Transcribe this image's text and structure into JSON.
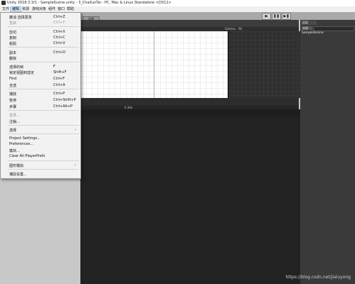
{
  "window": {
    "title": "Unity 2018.3.1f1 - SampleScene.unity - 3_ChaXunTai - PC, Mac & Linux Standalone <DX11>"
  },
  "menubar": {
    "items": [
      "文件",
      "编辑",
      "资源",
      "游戏对象",
      "组件",
      "窗口",
      "帮助"
    ]
  },
  "toolbar": {
    "scene_tab": "场景",
    "play": "▶",
    "pause": "❚❚",
    "step": "▶❚"
  },
  "edit_menu": {
    "undo": {
      "label": "撤消 选择更改",
      "shortcut": "Ctrl+Z"
    },
    "redo": {
      "label": "重做",
      "shortcut": "Ctrl+Y"
    },
    "cut": {
      "label": "剪切",
      "shortcut": "Ctrl+X"
    },
    "copy": {
      "label": "复制",
      "shortcut": "Ctrl+C"
    },
    "paste": {
      "label": "粘贴",
      "shortcut": "Ctrl+V"
    },
    "duplicate": {
      "label": "副本",
      "shortcut": "Ctrl+D"
    },
    "delete": {
      "label": "删除"
    },
    "frame_selected": {
      "label": "选择的帧",
      "shortcut": "F"
    },
    "lock_view": {
      "label": "锁定视图到选定",
      "shortcut": "Shift+F"
    },
    "find": {
      "label": "Find",
      "shortcut": "Ctrl+F"
    },
    "select_all": {
      "label": "全选",
      "shortcut": "Ctrl+A"
    },
    "play": {
      "label": "播放",
      "shortcut": "Ctrl+P"
    },
    "pause": {
      "label": "暂停",
      "shortcut": "Ctrl+Shift+P"
    },
    "step": {
      "label": "步骤",
      "shortcut": "Ctrl+Alt+P"
    },
    "sign_in": {
      "label": "登录..."
    },
    "sign_out": {
      "label": "注销..."
    },
    "selection": {
      "label": "选择"
    },
    "project_settings": {
      "label": "Project Settings..."
    },
    "preferences": {
      "label": "Preferences..."
    },
    "modules": {
      "label": "模块..."
    },
    "clear_prefs": {
      "label": "Clear All PlayerPrefs"
    },
    "graphics_emulation": {
      "label": "图形模拟"
    },
    "snap_settings": {
      "label": "捕捉设置..."
    }
  },
  "hierarchy": {
    "tab": "层级",
    "create": "创建",
    "scene": "SampleScene"
  },
  "scene_view": {
    "gizmos": "Gizmos",
    "all": "All"
  },
  "console": {
    "scale": "0.34x"
  },
  "watermark": "https://blog.csdn.net/jialuyong"
}
